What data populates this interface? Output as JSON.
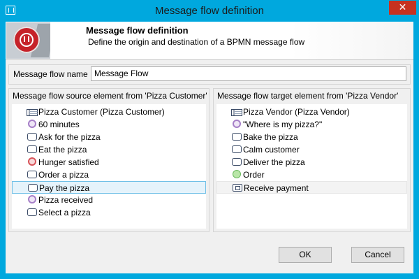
{
  "window": {
    "title": "Message flow definition",
    "close_label": "✕"
  },
  "banner": {
    "title": "Message flow definition",
    "subtitle": "Define the origin and destination of a BPMN message flow"
  },
  "name_field": {
    "label": "Message flow name",
    "value": "Message Flow"
  },
  "source": {
    "title": "Message flow source element from 'Pizza Customer'",
    "items": [
      {
        "label": "Pizza Customer (Pizza Customer)",
        "icon": "pool-icon"
      },
      {
        "label": "60 minutes",
        "icon": "timer-event-icon"
      },
      {
        "label": "Ask for the pizza",
        "icon": "task-icon"
      },
      {
        "label": "Eat the pizza",
        "icon": "task-icon"
      },
      {
        "label": "Hunger satisfied",
        "icon": "end-event-icon"
      },
      {
        "label": "Order a pizza",
        "icon": "task-icon"
      },
      {
        "label": "Pay the pizza",
        "icon": "task-icon",
        "selected": true
      },
      {
        "label": "Pizza received",
        "icon": "intermediate-event-icon"
      },
      {
        "label": "Select a pizza",
        "icon": "task-icon"
      }
    ]
  },
  "target": {
    "title": "Message flow target element from 'Pizza Vendor'",
    "items": [
      {
        "label": "Pizza Vendor (Pizza Vendor)",
        "icon": "pool-icon"
      },
      {
        "label": "\"Where is my pizza?\"",
        "icon": "intermediate-event-icon"
      },
      {
        "label": "Bake the pizza",
        "icon": "task-icon"
      },
      {
        "label": "Calm customer",
        "icon": "task-icon"
      },
      {
        "label": "Deliver the pizza",
        "icon": "task-icon"
      },
      {
        "label": "Order",
        "icon": "start-event-icon"
      },
      {
        "label": "Receive payment",
        "icon": "receive-task-icon",
        "highlighted": true
      }
    ]
  },
  "buttons": {
    "ok": "OK",
    "cancel": "Cancel"
  },
  "colors": {
    "titlebar": "#00a8de",
    "close_button": "#c7311f",
    "selection_fill": "#e5f3fb",
    "selection_border": "#70c0e7"
  }
}
